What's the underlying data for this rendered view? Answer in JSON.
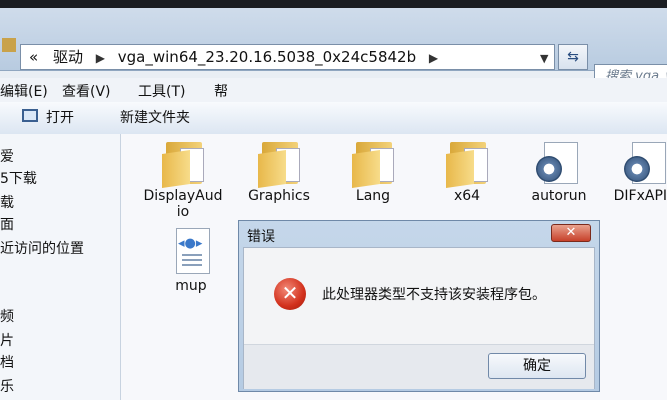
{
  "address": {
    "nav_back_icon": "double-chevron-left",
    "crumb_parent": "驱动",
    "crumb_current": "vga_win64_23.20.16.5038_0x24c5842b",
    "search_placeholder": "搜索 vga_win"
  },
  "menu": {
    "edit": "编辑(E)",
    "view": "查看(V)",
    "tools": "工具(T)",
    "help": "帮"
  },
  "toolbar": {
    "open": "打开",
    "new_folder": "新建文件夹"
  },
  "sidebar": {
    "items": [
      "爱",
      "5下载",
      "载",
      "面",
      "近访问的位置",
      "频",
      "片",
      "档",
      "乐"
    ]
  },
  "files": [
    {
      "name": "DisplayAudio",
      "type": "folder"
    },
    {
      "name": "Graphics",
      "type": "folder"
    },
    {
      "name": "Lang",
      "type": "folder"
    },
    {
      "name": "x64",
      "type": "folder"
    },
    {
      "name": "autorun",
      "type": "setup-info"
    },
    {
      "name": "DIFxAPI.d",
      "type": "setup-info"
    },
    {
      "name": "mup",
      "type": "html"
    }
  ],
  "dialog": {
    "title": "错误",
    "close_label": "✕",
    "message": "此处理器类型不支持该安装程序包。",
    "ok_label": "确定"
  },
  "colors": {
    "error_red": "#d2301c",
    "close_red": "#c7412a",
    "folder_yellow": "#e8b84a",
    "accent_blue": "#3a78c9"
  }
}
